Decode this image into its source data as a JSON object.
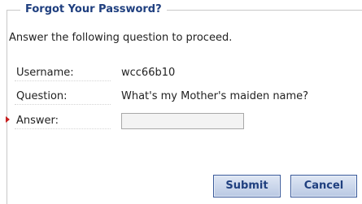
{
  "form": {
    "title": "Forgot Your Password?",
    "instruction": "Answer the following question to proceed.",
    "fields": [
      {
        "label": "Username:",
        "value": "wcc66b10"
      },
      {
        "label": "Question:",
        "value": "What's my Mother's maiden name?"
      },
      {
        "label": "Answer:",
        "value": "",
        "required": true
      }
    ],
    "buttons": {
      "submit_label": "Submit",
      "cancel_label": "Cancel"
    }
  },
  "colors": {
    "title": "#1f3f7f",
    "required_marker": "#c81e1e",
    "button_border": "#3a5a9a",
    "button_fill_top": "#dfe7f4",
    "button_fill_bottom": "#b9c8e3"
  },
  "icons": {
    "required_marker": "red-triangle-arrow-icon"
  }
}
